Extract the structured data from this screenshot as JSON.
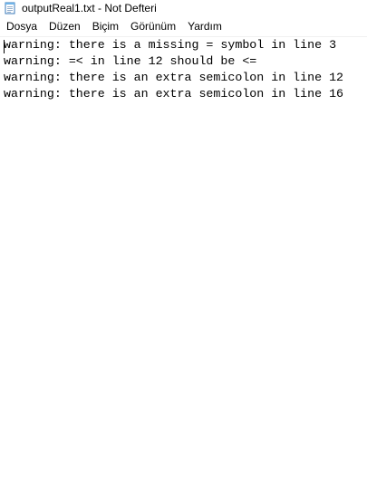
{
  "window": {
    "title": "outputReal1.txt - Not Defteri",
    "icon": "notepad-icon"
  },
  "menu": {
    "items": [
      {
        "label": "Dosya"
      },
      {
        "label": "Düzen"
      },
      {
        "label": "Biçim"
      },
      {
        "label": "Görünüm"
      },
      {
        "label": "Yardım"
      }
    ]
  },
  "editor": {
    "lines": [
      "warning: there is a missing = symbol in line 3",
      "warning: =< in line 12 should be <=",
      "warning: there is an extra semicolon in line 12",
      "warning: there is an extra semicolon in line 16"
    ]
  }
}
